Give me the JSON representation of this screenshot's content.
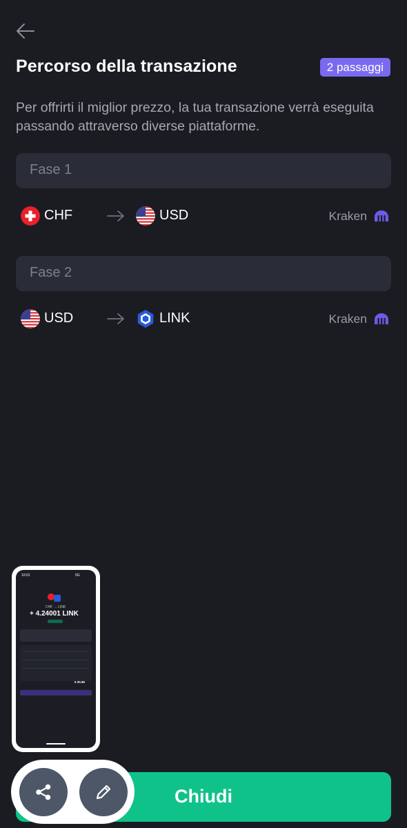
{
  "header": {
    "title": "Percorso della transazione",
    "badge": "2 passaggi"
  },
  "description": "Per offrirti il miglior prezzo, la tua transazione verrà eseguita passando attraverso diverse piattaforme.",
  "phases": [
    {
      "label": "Fase 1",
      "from": "CHF",
      "to": "USD",
      "venue": "Kraken"
    },
    {
      "label": "Fase 2",
      "from": "USD",
      "to": "LINK",
      "venue": "Kraken"
    }
  ],
  "colors": {
    "background": "#1b1c22",
    "accent": "#7a6af0",
    "primary_button": "#0fc28a",
    "card": "#2a2d38"
  },
  "icons": {
    "back": "arrow-left-icon",
    "share": "share-icon",
    "edit": "pencil-icon",
    "venue": "kraken-logo-icon"
  },
  "screenshot_preview": {
    "status_time": "10:01",
    "status_network": "5G",
    "pair": "CHF → LINK",
    "amount": "+ 4.24001 LINK",
    "total": "5 30.85"
  },
  "footer": {
    "close_label": "Chiudi"
  }
}
